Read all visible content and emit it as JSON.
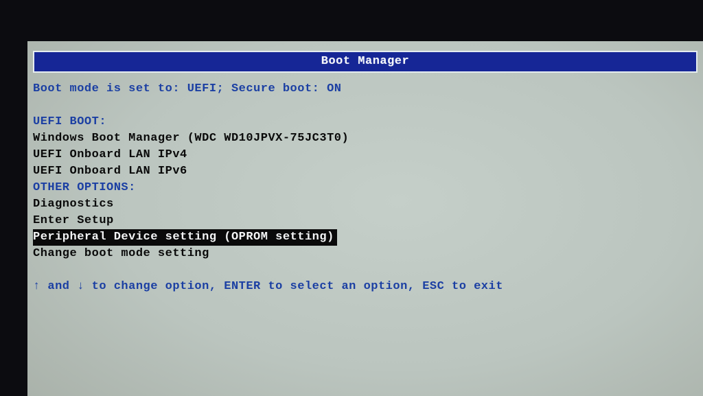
{
  "title": "Boot Manager",
  "status_line": "Boot mode is set to: UEFI; Secure boot: ON",
  "uefi_boot": {
    "heading": "UEFI BOOT:",
    "items": [
      "Windows Boot Manager (WDC WD10JPVX-75JC3T0)",
      "UEFI Onboard LAN IPv4",
      "UEFI Onboard LAN IPv6"
    ]
  },
  "other_options": {
    "heading": "OTHER OPTIONS:",
    "items": [
      "Diagnostics",
      "Enter Setup",
      "Peripheral Device setting (OPROM setting)",
      "Change boot mode setting"
    ],
    "selected_index": 2
  },
  "instructions": "↑ and ↓ to change option, ENTER to select an option, ESC to exit"
}
